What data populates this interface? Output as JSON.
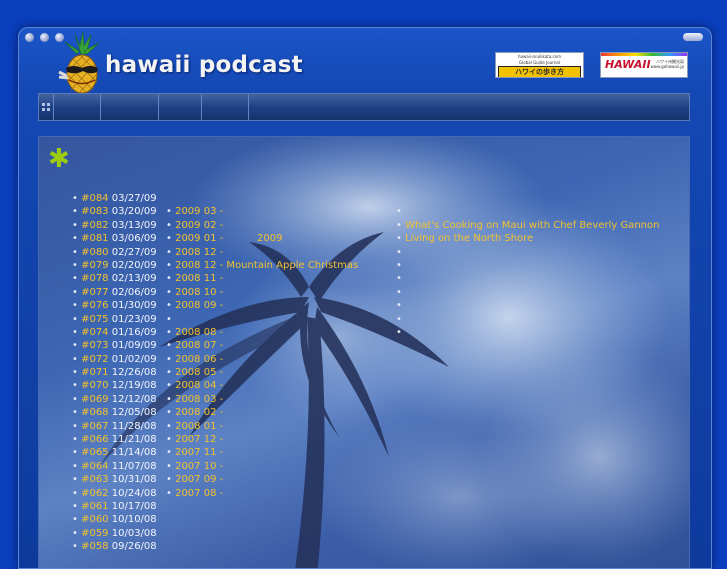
{
  "site": {
    "title": "hawaii podcast"
  },
  "banners": {
    "left": {
      "top_text": "hawaii-arukikata.com",
      "sub_text": "Global Guide Journal",
      "main_text": "ハワイの歩き方"
    },
    "right": {
      "main_text": "HAWAII",
      "small_text": "ハワイ州観光局",
      "url_text": "www.gohawaii.jp"
    }
  },
  "colors": {
    "background": "#0a3fbe",
    "link": "#f2c230",
    "accent": "#9ccc12",
    "date_text": "#f3f5fb"
  },
  "icons": {
    "logo": "pineapple-logo-icon",
    "heading": "asterisk-icon",
    "nav": "grid-icon"
  },
  "episodes": [
    {
      "id": "#084",
      "date": "03/27/09"
    },
    {
      "id": "#083",
      "date": "03/20/09"
    },
    {
      "id": "#082",
      "date": "03/13/09"
    },
    {
      "id": "#081",
      "date": "03/06/09"
    },
    {
      "id": "#080",
      "date": "02/27/09"
    },
    {
      "id": "#079",
      "date": "02/20/09"
    },
    {
      "id": "#078",
      "date": "02/13/09"
    },
    {
      "id": "#077",
      "date": "02/06/09"
    },
    {
      "id": "#076",
      "date": "01/30/09"
    },
    {
      "id": "#075",
      "date": "01/23/09"
    },
    {
      "id": "#074",
      "date": "01/16/09"
    },
    {
      "id": "#073",
      "date": "01/09/09"
    },
    {
      "id": "#072",
      "date": "01/02/09"
    },
    {
      "id": "#071",
      "date": "12/26/08"
    },
    {
      "id": "#070",
      "date": "12/19/08"
    },
    {
      "id": "#069",
      "date": "12/12/08"
    },
    {
      "id": "#068",
      "date": "12/05/08"
    },
    {
      "id": "#067",
      "date": "11/28/08"
    },
    {
      "id": "#066",
      "date": "11/21/08"
    },
    {
      "id": "#065",
      "date": "11/14/08"
    },
    {
      "id": "#064",
      "date": "11/07/08"
    },
    {
      "id": "#063",
      "date": "10/31/08"
    },
    {
      "id": "#062",
      "date": "10/24/08"
    },
    {
      "id": "#061",
      "date": "10/17/08"
    },
    {
      "id": "#060",
      "date": "10/10/08"
    },
    {
      "id": "#059",
      "date": "10/03/08"
    },
    {
      "id": "#058",
      "date": "09/26/08"
    }
  ],
  "archives": [
    {
      "label": "2009 03",
      "extra": ""
    },
    {
      "label": "2009 02",
      "extra": ""
    },
    {
      "label": "2009 01",
      "extra": ""
    },
    {
      "label": "2008 12",
      "extra": ""
    },
    {
      "label": "2008 12",
      "extra": "Mountain Apple Christmas"
    },
    {
      "label": "2008 11",
      "extra": ""
    },
    {
      "label": "2008 10",
      "extra": ""
    },
    {
      "label": "2008 09",
      "extra": ""
    },
    {
      "label": "",
      "extra": ""
    },
    {
      "label": "2008 08",
      "extra": ""
    },
    {
      "label": "2008 07",
      "extra": ""
    },
    {
      "label": "2008 06",
      "extra": ""
    },
    {
      "label": "2008 05",
      "extra": ""
    },
    {
      "label": "2008 04",
      "extra": ""
    },
    {
      "label": "2008 03",
      "extra": ""
    },
    {
      "label": "2008 02",
      "extra": ""
    },
    {
      "label": "2008 01",
      "extra": ""
    },
    {
      "label": "2007 12",
      "extra": ""
    },
    {
      "label": "2007 11",
      "extra": ""
    },
    {
      "label": "2007 10",
      "extra": ""
    },
    {
      "label": "2007 09",
      "extra": ""
    },
    {
      "label": "2007 08",
      "extra": ""
    }
  ],
  "archive_year_label": "2009",
  "features": [
    {
      "title": ""
    },
    {
      "title": "What's Cooking on Maui with Chef Beverly Gannon"
    },
    {
      "title": "Living on the North Shore"
    },
    {
      "title": ""
    },
    {
      "title": ""
    },
    {
      "title": ""
    },
    {
      "title": ""
    },
    {
      "title": ""
    },
    {
      "title": ""
    },
    {
      "title": ""
    }
  ]
}
